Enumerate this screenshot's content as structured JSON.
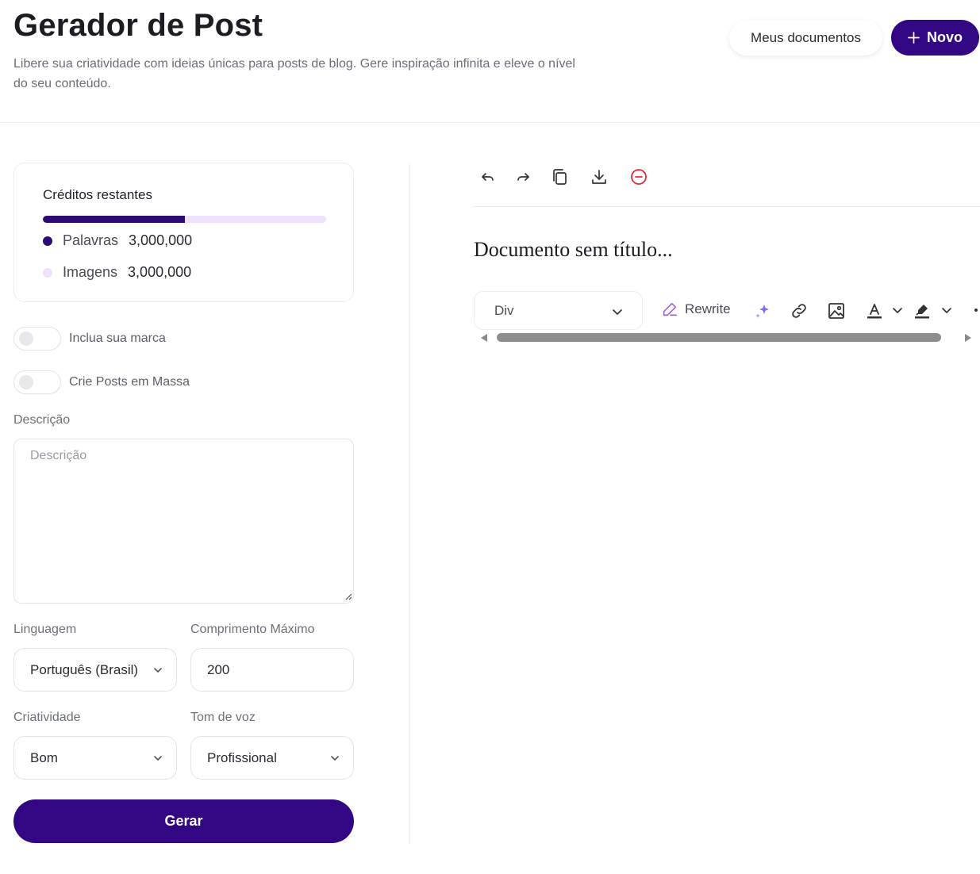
{
  "header": {
    "title": "Gerador de Post",
    "subtitle": "Libere sua criatividade com ideias únicas para posts de blog. Gere inspiração infinita e eleve o nível do seu conteúdo.",
    "docs_button": "Meus documentos",
    "new_button": "Novo"
  },
  "credits": {
    "title": "Créditos restantes",
    "progress_fraction": 0.5,
    "words_label": "Palavras",
    "words_value": "3,000,000",
    "images_label": "Imagens",
    "images_value": "3,000,000",
    "words_color": "#2c0b74",
    "images_color": "#f0e1fb"
  },
  "toggles": {
    "brand_label": "Inclua sua marca",
    "brand_on": false,
    "bulk_label": "Crie Posts em Massa",
    "bulk_on": false
  },
  "form": {
    "description_label": "Descrição",
    "description_placeholder": "Descrição",
    "description_value": "",
    "language_label": "Linguagem",
    "language_value": "Português (Brasil)",
    "max_length_label": "Comprimento Máximo",
    "max_length_value": "200",
    "creativity_label": "Criatividade",
    "creativity_value": "Bom",
    "tone_label": "Tom de voz",
    "tone_value": "Profissional",
    "generate_button": "Gerar"
  },
  "editor": {
    "doc_title": "Documento sem título...",
    "format_value": "Div",
    "rewrite_label": "Rewrite",
    "icons": [
      "undo-icon",
      "redo-icon",
      "copy-icon",
      "download-icon",
      "delete-icon",
      "pencil-icon",
      "sparkles-icon",
      "link-icon",
      "image-icon",
      "text-color-icon",
      "highlight-icon"
    ]
  },
  "colors": {
    "primary": "#330783",
    "danger": "#e5283a",
    "accent_purple": "#a35ad8",
    "sparkle": "#7b6cf0"
  }
}
